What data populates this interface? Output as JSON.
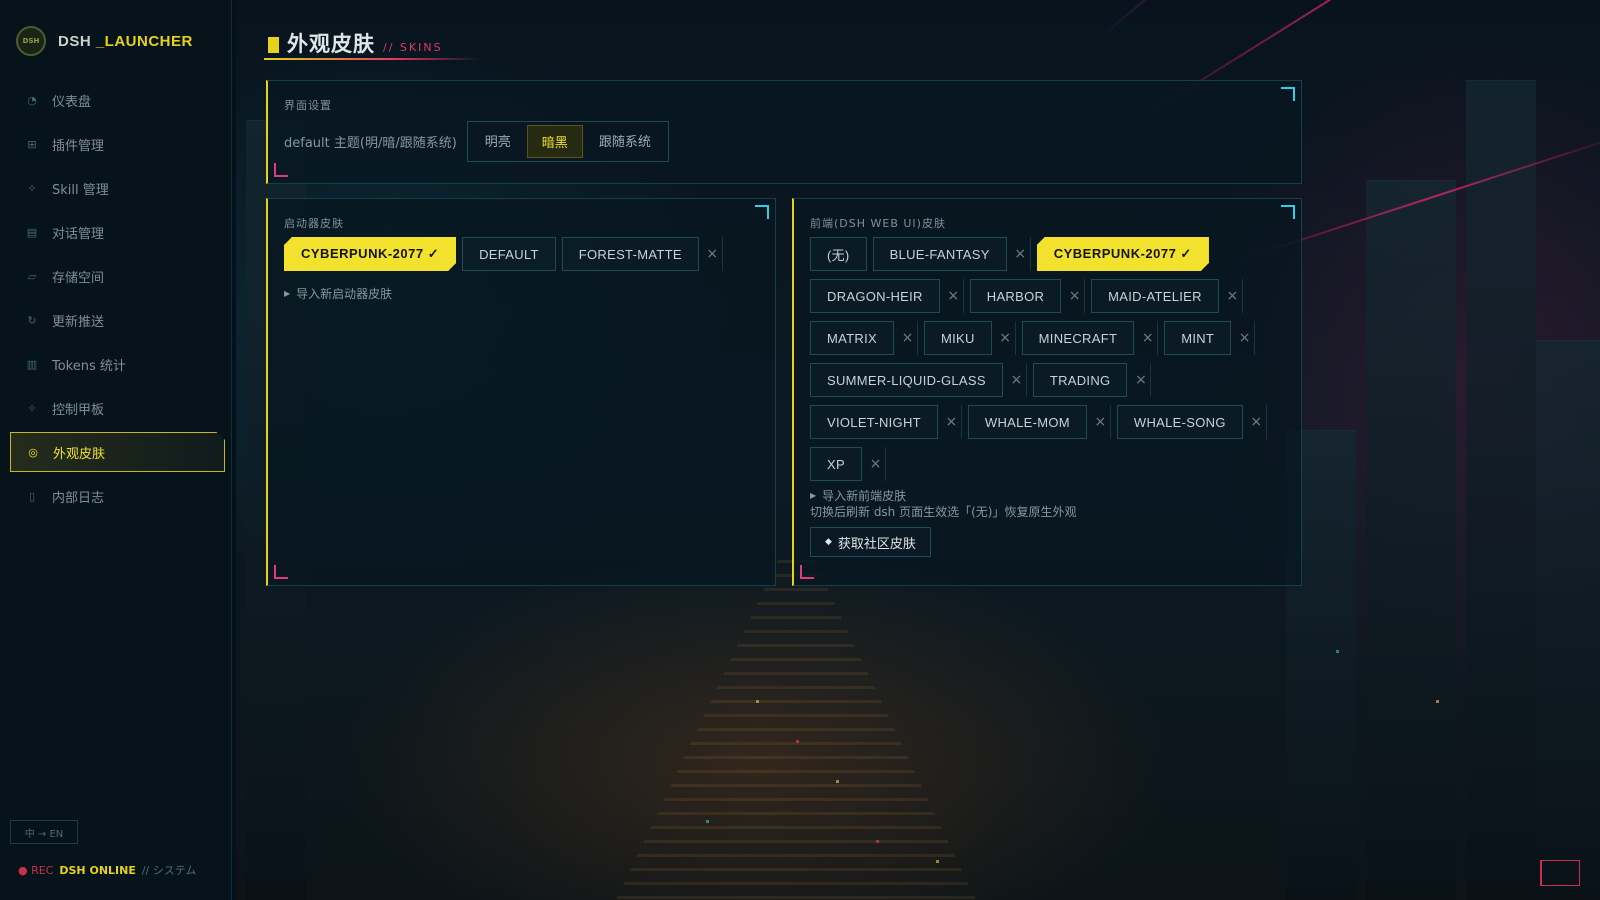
{
  "brand": {
    "logo_text": "DSH",
    "name_a": "DSH",
    "name_b": "_LAUNCHER"
  },
  "sidebar": {
    "items": [
      {
        "icon": "dashboard-icon",
        "glyph": "◔",
        "label": "仪表盘"
      },
      {
        "icon": "plugin-icon",
        "glyph": "⊞",
        "label": "插件管理"
      },
      {
        "icon": "skill-icon",
        "glyph": "✧",
        "label": "Skill 管理"
      },
      {
        "icon": "chat-icon",
        "glyph": "▤",
        "label": "对话管理"
      },
      {
        "icon": "storage-icon",
        "glyph": "▱",
        "label": "存储空间"
      },
      {
        "icon": "refresh-icon",
        "glyph": "↻",
        "label": "更新推送"
      },
      {
        "icon": "bar-chart-icon",
        "glyph": "▥",
        "label": "Tokens 统计"
      },
      {
        "icon": "control-icon",
        "glyph": "✧",
        "label": "控制甲板"
      },
      {
        "icon": "palette-icon",
        "glyph": "◎",
        "label": "外观皮肤",
        "active": true
      },
      {
        "icon": "log-icon",
        "glyph": "▯",
        "label": "内部日志"
      }
    ],
    "lang_toggle": "中 → EN",
    "status_rec": "● REC",
    "status_online": "DSH ONLINE",
    "status_sys": "// システム"
  },
  "header": {
    "title": "外观皮肤",
    "subtitle": "// SKINS"
  },
  "theme_panel": {
    "label": "界面设置",
    "row_label": "default 主题(明/暗/跟随系统)",
    "options": [
      "明亮",
      "暗黑",
      "跟随系统"
    ],
    "selected": "暗黑"
  },
  "launcher_panel": {
    "label": "启动器皮肤",
    "skins": [
      {
        "name": "CYBERPUNK-2077 ✓",
        "selected": true,
        "removable": false
      },
      {
        "name": "DEFAULT",
        "selected": false,
        "removable": false
      },
      {
        "name": "FOREST-MATTE",
        "selected": false,
        "removable": true
      }
    ],
    "import_label": "导入新启动器皮肤"
  },
  "web_panel": {
    "label": "前端(DSH WEB UI)皮肤",
    "skins": [
      {
        "name": "(无)",
        "selected": false,
        "removable": false
      },
      {
        "name": "BLUE-FANTASY",
        "selected": false,
        "removable": true
      },
      {
        "name": "CYBERPUNK-2077 ✓",
        "selected": true,
        "removable": false
      },
      {
        "name": "DRAGON-HEIR",
        "selected": false,
        "removable": true
      },
      {
        "name": "HARBOR",
        "selected": false,
        "removable": true
      },
      {
        "name": "MAID-ATELIER",
        "selected": false,
        "removable": true
      },
      {
        "name": "MATRIX",
        "selected": false,
        "removable": true
      },
      {
        "name": "MIKU",
        "selected": false,
        "removable": true
      },
      {
        "name": "MINECRAFT",
        "selected": false,
        "removable": true
      },
      {
        "name": "MINT",
        "selected": false,
        "removable": true
      },
      {
        "name": "SUMMER-LIQUID-GLASS",
        "selected": false,
        "removable": true
      },
      {
        "name": "TRADING",
        "selected": false,
        "removable": true
      },
      {
        "name": "VIOLET-NIGHT",
        "selected": false,
        "removable": true
      },
      {
        "name": "WHALE-MOM",
        "selected": false,
        "removable": true
      },
      {
        "name": "WHALE-SONG",
        "selected": false,
        "removable": true
      },
      {
        "name": "XP",
        "selected": false,
        "removable": true
      }
    ],
    "import_label": "导入新前端皮肤",
    "note": "切换后刷新 dsh 页面生效选「(无)」恢复原生外观",
    "community_label": "获取社区皮肤",
    "community_glyph": "◆",
    "remove_glyph": "×"
  },
  "colors": {
    "accent_yellow": "#f2e22e",
    "accent_cyan": "#2fd0e6",
    "accent_pink": "#e23a7a",
    "rec_red": "#c8304c"
  }
}
